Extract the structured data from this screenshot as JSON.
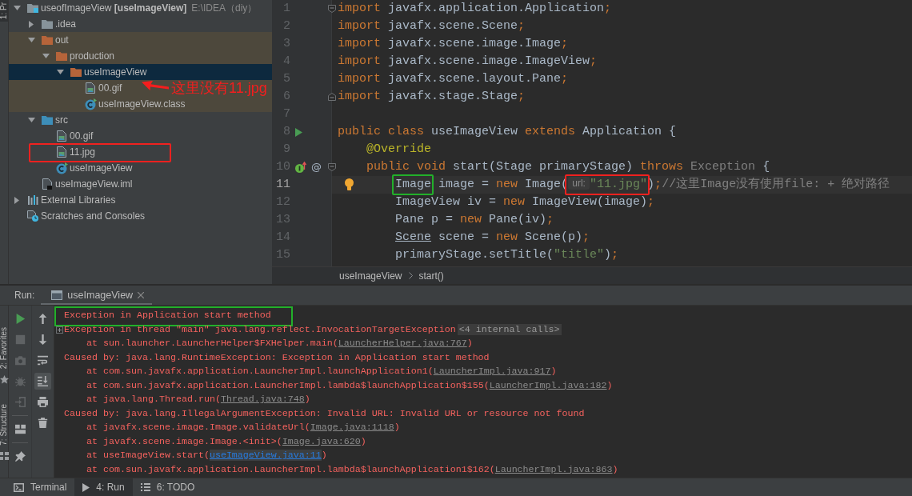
{
  "left_strip_tabs": [
    {
      "label": "1: Pr",
      "selected": true
    }
  ],
  "project_tree": [
    {
      "label": "useofImageView **[useImageView]**",
      "path": "E:\\IDEA（diy）",
      "kind": "module",
      "expanded": true,
      "selected": false,
      "children": [
        {
          "label": ".idea",
          "kind": "folder",
          "expanded": false,
          "selected": false
        },
        {
          "label": "out",
          "kind": "excluded-folder",
          "expanded": true,
          "selected": false,
          "children": [
            {
              "label": "production",
              "kind": "excluded-folder",
              "expanded": true,
              "selected": false,
              "children": [
                {
                  "label": "useImageView",
                  "kind": "excluded-folder",
                  "expanded": true,
                  "selected": true,
                  "children": [
                    {
                      "label": "00.gif",
                      "kind": "image",
                      "selected": false,
                      "callout": {
                        "text": "这里没有11.jpg"
                      }
                    },
                    {
                      "label": "useImageView.class",
                      "kind": "class",
                      "selected": false
                    }
                  ]
                }
              ]
            }
          ]
        },
        {
          "label": "src",
          "kind": "source-folder",
          "expanded": true,
          "selected": false,
          "children": [
            {
              "label": "00.gif",
              "kind": "image",
              "selected": false
            },
            {
              "label": "11.jpg",
              "kind": "image",
              "selected": false,
              "box": {
                "color": "#f0211f"
              }
            },
            {
              "label": "useImageView",
              "kind": "class",
              "selected": false
            }
          ]
        },
        {
          "label": "useImageView.iml",
          "kind": "module-file",
          "selected": false
        }
      ]
    },
    {
      "label": "External Libraries",
      "kind": "libraries",
      "expanded": false,
      "selected": false
    },
    {
      "label": "Scratches and Consoles",
      "kind": "scratches",
      "selected": false
    }
  ],
  "editor": {
    "lines": [
      {
        "number": "1",
        "current": false,
        "fold": {
          "kind": "start"
        },
        "tokens": [
          {
            "kind": "keyword",
            "text": "import"
          },
          {
            "kind": "plain",
            "text": " javafx.application.Application"
          },
          {
            "kind": "keyword",
            "text": ";"
          }
        ]
      },
      {
        "number": "2",
        "current": false,
        "tokens": [
          {
            "kind": "keyword",
            "text": "import"
          },
          {
            "kind": "plain",
            "text": " javafx.scene.Scene"
          },
          {
            "kind": "keyword",
            "text": ";"
          }
        ]
      },
      {
        "number": "3",
        "current": false,
        "tokens": [
          {
            "kind": "keyword",
            "text": "import"
          },
          {
            "kind": "plain",
            "text": " javafx.scene.image.Image"
          },
          {
            "kind": "keyword",
            "text": ";"
          }
        ]
      },
      {
        "number": "4",
        "current": false,
        "tokens": [
          {
            "kind": "keyword",
            "text": "import"
          },
          {
            "kind": "plain",
            "text": " javafx.scene.image.ImageView"
          },
          {
            "kind": "keyword",
            "text": ";"
          }
        ]
      },
      {
        "number": "5",
        "current": false,
        "tokens": [
          {
            "kind": "keyword",
            "text": "import"
          },
          {
            "kind": "plain",
            "text": " javafx.scene.layout.Pane"
          },
          {
            "kind": "keyword",
            "text": ";"
          }
        ]
      },
      {
        "number": "6",
        "current": false,
        "fold": {
          "kind": "end"
        },
        "tokens": [
          {
            "kind": "keyword",
            "text": "import"
          },
          {
            "kind": "plain",
            "text": " javafx.stage.Stage"
          },
          {
            "kind": "keyword",
            "text": ";"
          }
        ]
      },
      {
        "number": "7",
        "current": false
      },
      {
        "number": "8",
        "current": false,
        "gutter": {
          "kind": "run"
        },
        "tokens": [
          {
            "kind": "keyword",
            "text": "public class"
          },
          {
            "kind": "plain",
            "text": " useImageView "
          },
          {
            "kind": "keyword",
            "text": "extends"
          },
          {
            "kind": "plain",
            "text": " Application {"
          }
        ]
      },
      {
        "number": "9",
        "current": false,
        "tokens": [
          {
            "kind": "annotation",
            "text": "    @Override"
          }
        ]
      },
      {
        "number": "10",
        "current": false,
        "gutter": {
          "kind": "override"
        },
        "gutter_mark": "@",
        "fold": {
          "kind": "start"
        },
        "tokens": [
          {
            "kind": "keyword",
            "text": "    public void"
          },
          {
            "kind": "plain",
            "text": " start(Stage primaryStage) "
          },
          {
            "kind": "keyword",
            "text": "throws"
          },
          {
            "kind": "muted",
            "text": " Exception"
          },
          {
            "kind": "plain",
            "text": " {"
          }
        ]
      },
      {
        "number": "11",
        "current": true,
        "intention_bulb": true,
        "tokens": [
          {
            "kind": "plain",
            "text": "        Image",
            "box": {
              "color": "#22b02a"
            }
          },
          {
            "kind": "plain",
            "text": " image = "
          },
          {
            "kind": "keyword",
            "text": "new"
          },
          {
            "kind": "plain",
            "text": " Image("
          },
          {
            "kind": "hint",
            "text": "url:",
            "box": {
              "color": "#f0211f"
            }
          },
          {
            "kind": "string",
            "text": "\"11.jpg\"",
            "box": {
              "color": "#f0211f"
            }
          },
          {
            "kind": "plain",
            "text": ")"
          },
          {
            "kind": "keyword",
            "text": ";"
          },
          {
            "kind": "comment",
            "text": "//这里Image没有使用file: + 绝对路径"
          }
        ]
      },
      {
        "number": "12",
        "current": false,
        "tokens": [
          {
            "kind": "plain",
            "text": "        ImageView iv = "
          },
          {
            "kind": "keyword",
            "text": "new"
          },
          {
            "kind": "plain",
            "text": " ImageView(image)"
          },
          {
            "kind": "keyword",
            "text": ";"
          }
        ]
      },
      {
        "number": "13",
        "current": false,
        "tokens": [
          {
            "kind": "plain",
            "text": "        Pane p = "
          },
          {
            "kind": "keyword",
            "text": "new"
          },
          {
            "kind": "plain",
            "text": " Pane(iv)"
          },
          {
            "kind": "keyword",
            "text": ";"
          }
        ]
      },
      {
        "number": "14",
        "current": false,
        "tokens": [
          {
            "kind": "underlined",
            "text": "        Scene"
          },
          {
            "kind": "plain",
            "text": " scene = "
          },
          {
            "kind": "keyword",
            "text": "new"
          },
          {
            "kind": "plain",
            "text": " Scene(p)"
          },
          {
            "kind": "keyword",
            "text": ";"
          }
        ]
      },
      {
        "number": "15",
        "current": false,
        "tokens": [
          {
            "kind": "plain",
            "text": "        primaryStage.setTitle("
          },
          {
            "kind": "string",
            "text": "\"title\""
          },
          {
            "kind": "plain",
            "text": ")"
          },
          {
            "kind": "keyword",
            "text": ";"
          }
        ]
      }
    ],
    "breadcrumbs": [
      "useImageView",
      "start()"
    ]
  },
  "run_panel": {
    "title": "Run:",
    "tabs": [
      {
        "label": "useImageView",
        "selected": true
      }
    ],
    "side_tabs": [
      {
        "label": "2: Favorites",
        "kind": "favorites",
        "selected": false
      },
      {
        "label": "7: Structure",
        "kind": "structure",
        "selected": false
      }
    ],
    "toolbar_left": [
      {
        "kind": "rerun",
        "disabled": false
      },
      {
        "kind": "stop",
        "disabled": true
      },
      {
        "kind": "dump-threads",
        "disabled": true
      },
      {
        "kind": "debug",
        "disabled": true
      },
      {
        "kind": "restore",
        "disabled": true
      },
      {
        "kind": "separator"
      },
      {
        "kind": "layout",
        "disabled": false
      },
      {
        "kind": "separator"
      },
      {
        "kind": "pin",
        "disabled": false
      }
    ],
    "toolbar_right": [
      {
        "kind": "up",
        "selected": false
      },
      {
        "kind": "down",
        "selected": false
      },
      {
        "kind": "soft-wrap",
        "selected": false
      },
      {
        "kind": "scroll-to-end",
        "selected": true
      },
      {
        "kind": "print",
        "selected": false
      },
      {
        "kind": "clear",
        "selected": false
      }
    ],
    "console": [
      {
        "kind": "message",
        "text": "Exception in Application start method",
        "box": {
          "color": "#22b02a"
        }
      },
      {
        "kind": "message",
        "text": "Exception in thread \"main\" java.lang.reflect.InvocationTargetException",
        "folded_calls": "<4 internal calls>"
      },
      {
        "kind": "frame",
        "text": "at sun.launcher.LauncherHelper$FXHelper.main(",
        "link": {
          "kind": "library",
          "text": "LauncherHelper.java:767"
        },
        "tail": ")"
      },
      {
        "kind": "message",
        "text": "Caused by: java.lang.RuntimeException: Exception in Application start method"
      },
      {
        "kind": "frame",
        "text": "at com.sun.javafx.application.LauncherImpl.launchApplication1(",
        "link": {
          "kind": "library",
          "text": "LauncherImpl.java:917"
        },
        "tail": ")"
      },
      {
        "kind": "frame",
        "text": "at com.sun.javafx.application.LauncherImpl.lambda$launchApplication$155(",
        "link": {
          "kind": "library",
          "text": "LauncherImpl.java:182"
        },
        "tail": ")"
      },
      {
        "kind": "frame",
        "text": "at java.lang.Thread.run(",
        "link": {
          "kind": "library",
          "text": "Thread.java:748"
        },
        "tail": ")"
      },
      {
        "kind": "message",
        "text": "Caused by: java.lang.IllegalArgumentException: Invalid URL: Invalid URL or resource not found"
      },
      {
        "kind": "frame",
        "text": "at javafx.scene.image.Image.validateUrl(",
        "link": {
          "kind": "library",
          "text": "Image.java:1118"
        },
        "tail": ")"
      },
      {
        "kind": "frame",
        "text": "at javafx.scene.image.Image.<init>(",
        "link": {
          "kind": "library",
          "text": "Image.java:620"
        },
        "tail": ")"
      },
      {
        "kind": "frame",
        "text": "at useImageView.start(",
        "link": {
          "kind": "project",
          "text": "useImageView.java:11"
        },
        "tail": ")"
      },
      {
        "kind": "frame",
        "text": "at com.sun.javafx.application.LauncherImpl.lambda$launchApplication1$162(",
        "link": {
          "kind": "library",
          "text": "LauncherImpl.java:863"
        },
        "tail": ")"
      }
    ]
  },
  "bottom_bar": [
    {
      "kind": "terminal",
      "label": "Terminal",
      "selected": false
    },
    {
      "kind": "run",
      "label": "4: Run",
      "selected": true
    },
    {
      "kind": "todo",
      "label": "6: TODO",
      "selected": false
    }
  ]
}
